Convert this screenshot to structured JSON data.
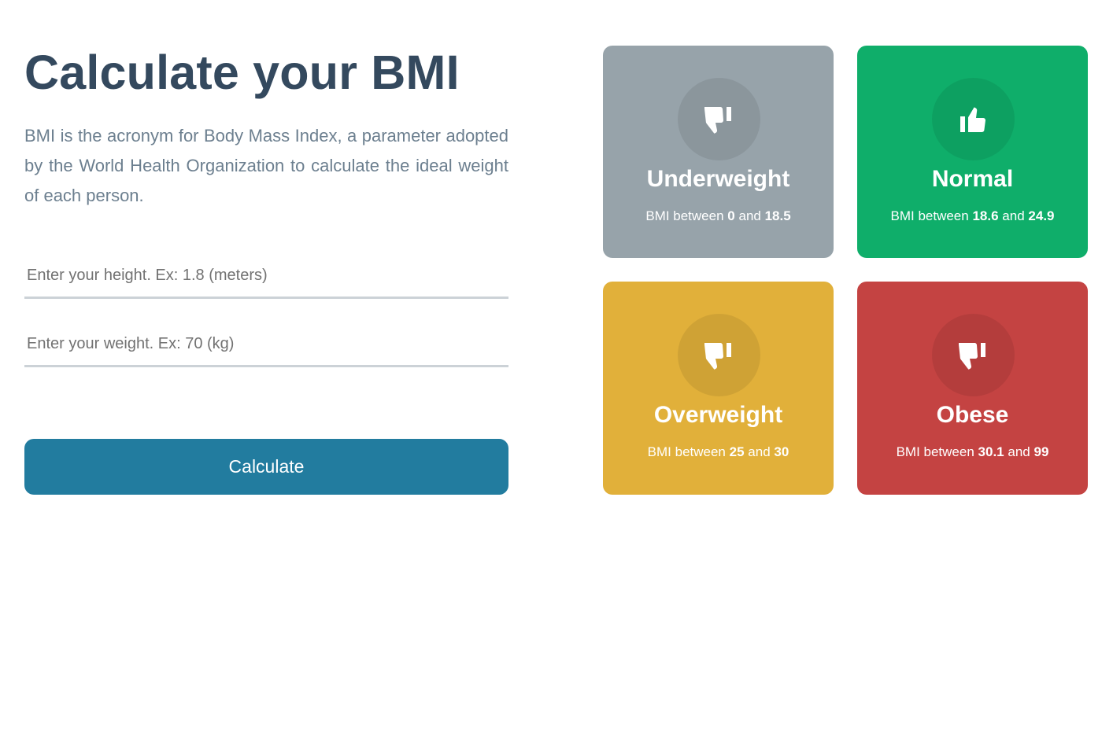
{
  "header": {
    "title": "Calculate your BMI",
    "description": "BMI is the acronym for Body Mass Index, a parameter adopted by the World Health Organization to calculate the ideal weight of each person."
  },
  "form": {
    "height_placeholder": "Enter your height. Ex: 1.8 (meters)",
    "weight_placeholder": "Enter your weight. Ex: 70 (kg)",
    "calculate_label": "Calculate"
  },
  "categories": [
    {
      "label": "Underweight",
      "range_prefix": "BMI between",
      "min": "0",
      "and": "and",
      "max": "18.5",
      "color": "#97a3aa",
      "icon": "thumbs-down-icon"
    },
    {
      "label": "Normal",
      "range_prefix": "BMI between",
      "min": "18.6",
      "and": "and",
      "max": "24.9",
      "color": "#0fae6a",
      "icon": "thumbs-up-icon"
    },
    {
      "label": "Overweight",
      "range_prefix": "BMI between",
      "min": "25",
      "and": "and",
      "max": "30",
      "color": "#e1b03a",
      "icon": "thumbs-down-icon"
    },
    {
      "label": "Obese",
      "range_prefix": "BMI between",
      "min": "30.1",
      "and": "and",
      "max": "99",
      "color": "#c44342",
      "icon": "thumbs-down-icon"
    }
  ]
}
